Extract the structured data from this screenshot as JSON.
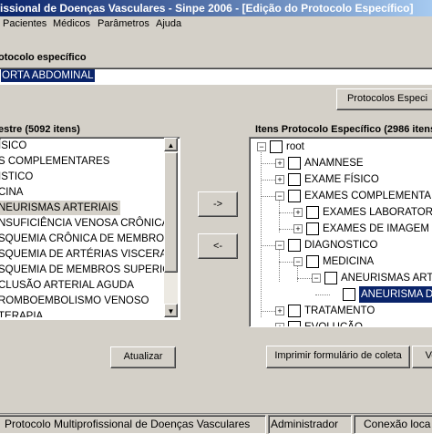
{
  "window": {
    "title": "fissional de Doenças Vasculares - Sinpe 2006 - [Edição do Protocolo Específico]"
  },
  "menu": {
    "items": [
      "Pacientes",
      "Médicos",
      "Parâmetros",
      "Ajuda"
    ]
  },
  "protocol": {
    "label": "otocolo específico",
    "value": "ORTA ABDOMINAL",
    "protocols_button": "Protocolos Especi"
  },
  "master": {
    "header": "estre (5092 itens)",
    "items": [
      "ÍSICO",
      "S COMPLEMENTARES",
      "ISTICO",
      "CINA",
      "NEURISMAS ARTERIAIS",
      "NSUFICIÊNCIA VENOSA CRÔNICA",
      "SQUEMIA CRÔNICA DE MEMBROS INF",
      "SQUEMIA DE ARTÉRIAS VISCERAIS",
      "SQUEMIA DE MEMBROS SUPERIORES",
      "CLUSÃO ARTERIAL AGUDA",
      "ROMBOEMBOLISMO VENOSO",
      "TERAPIA"
    ],
    "selected_index": 4,
    "update_button": "Atualizar"
  },
  "transfer": {
    "add_button": "->",
    "remove_button": "<-"
  },
  "specific": {
    "header": "Itens Protocolo Específico (2986 itens)",
    "tree": [
      {
        "label": "root",
        "level": 0,
        "expander": "minus"
      },
      {
        "label": "ANAMNESE",
        "level": 1,
        "expander": "plus"
      },
      {
        "label": "EXAME FÍSICO",
        "level": 1,
        "expander": "plus"
      },
      {
        "label": "EXAMES COMPLEMENTARES",
        "level": 1,
        "expander": "minus"
      },
      {
        "label": "EXAMES LABORATORIAIS",
        "level": 2,
        "expander": "plus"
      },
      {
        "label": "EXAMES DE IMAGEM",
        "level": 2,
        "expander": "plus"
      },
      {
        "label": "DIAGNOSTICO",
        "level": 1,
        "expander": "minus"
      },
      {
        "label": "MEDICINA",
        "level": 2,
        "expander": "minus"
      },
      {
        "label": "ANEURISMAS ARTERI",
        "level": 3,
        "expander": "minus"
      },
      {
        "label": "ANEURISMA DA A",
        "level": 4,
        "expander": "none",
        "selected": true
      },
      {
        "label": "TRATAMENTO",
        "level": 1,
        "expander": "plus"
      },
      {
        "label": "EVOLUÇÃO",
        "level": 1,
        "expander": "plus"
      }
    ],
    "print_button": "Imprimir formulário de coleta",
    "view_button": "Ve"
  },
  "status": {
    "cells": [
      "Protocolo Multiprofissional de Doenças Vasculares",
      "Administrador",
      "Conexão loca"
    ]
  }
}
